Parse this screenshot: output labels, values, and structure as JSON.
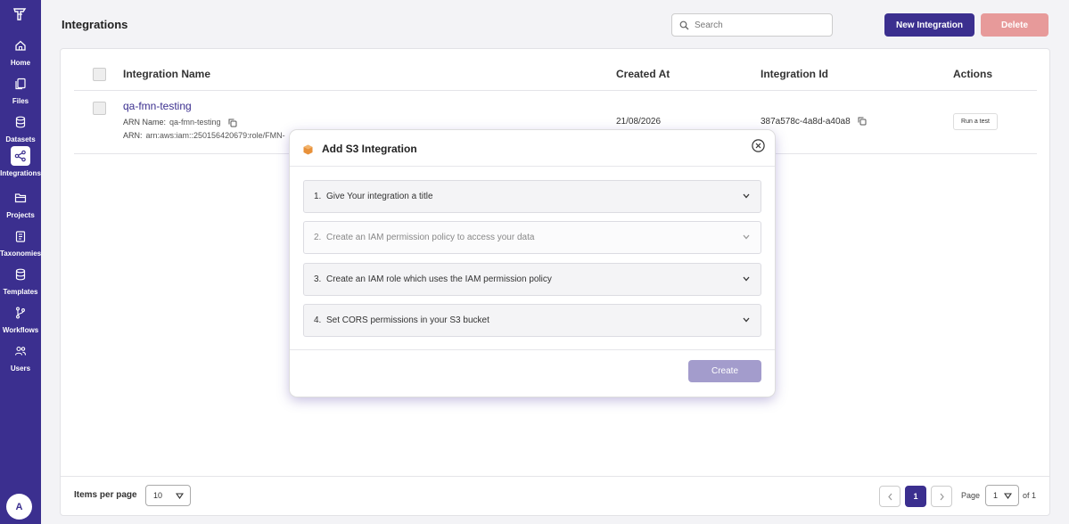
{
  "sidebar": {
    "items": [
      {
        "label": "Home",
        "icon": "home-icon"
      },
      {
        "label": "Files",
        "icon": "files-icon"
      },
      {
        "label": "Datasets",
        "icon": "database-icon"
      },
      {
        "label": "Integrations",
        "icon": "share-icon"
      },
      {
        "label": "Projects",
        "icon": "folder-icon"
      },
      {
        "label": "Taxonomies",
        "icon": "clipboard-icon"
      },
      {
        "label": "Templates",
        "icon": "database-icon"
      },
      {
        "label": "Workflows",
        "icon": "branch-icon"
      },
      {
        "label": "Users",
        "icon": "users-icon"
      }
    ],
    "avatar": "A"
  },
  "header": {
    "title": "Integrations",
    "search_placeholder": "Search",
    "new_label": "New Integration",
    "delete_label": "Delete"
  },
  "table": {
    "headers": [
      "Integration Name",
      "Created At",
      "Integration Id",
      "Actions"
    ],
    "row": {
      "name": "qa-fmn-testing",
      "arn_name_label": "ARN Name:",
      "arn_name": "qa-fmn-testing",
      "arn_label": "ARN:",
      "arn": "arn:aws:iam::250156420679:role/FMN-",
      "created_at": "21/08/2026",
      "integration_id": "387a578c-4a8d-a40a8",
      "action": "Run a test"
    }
  },
  "footer": {
    "items_per_page_label": "Items per page",
    "items_per_page": "10",
    "current_page": "1",
    "page_label": "Page",
    "page_select": "1",
    "of_label": "of 1"
  },
  "modal": {
    "title": "Add S3 Integration",
    "steps": [
      {
        "num": "1.",
        "text": "Give Your integration a title",
        "disabled": false
      },
      {
        "num": "2.",
        "text": "Create an IAM permission policy to access your data",
        "disabled": true
      },
      {
        "num": "3.",
        "text": "Create an IAM role which uses the IAM permission policy",
        "disabled": false
      },
      {
        "num": "4.",
        "text": "Set CORS permissions in your S3 bucket",
        "disabled": false
      }
    ],
    "create_label": "Create"
  },
  "colors": {
    "brand": "#3b2f8f",
    "delete": "#e79a9a",
    "create_disabled": "#a39ccc",
    "s3_logo": "#e8913a"
  }
}
